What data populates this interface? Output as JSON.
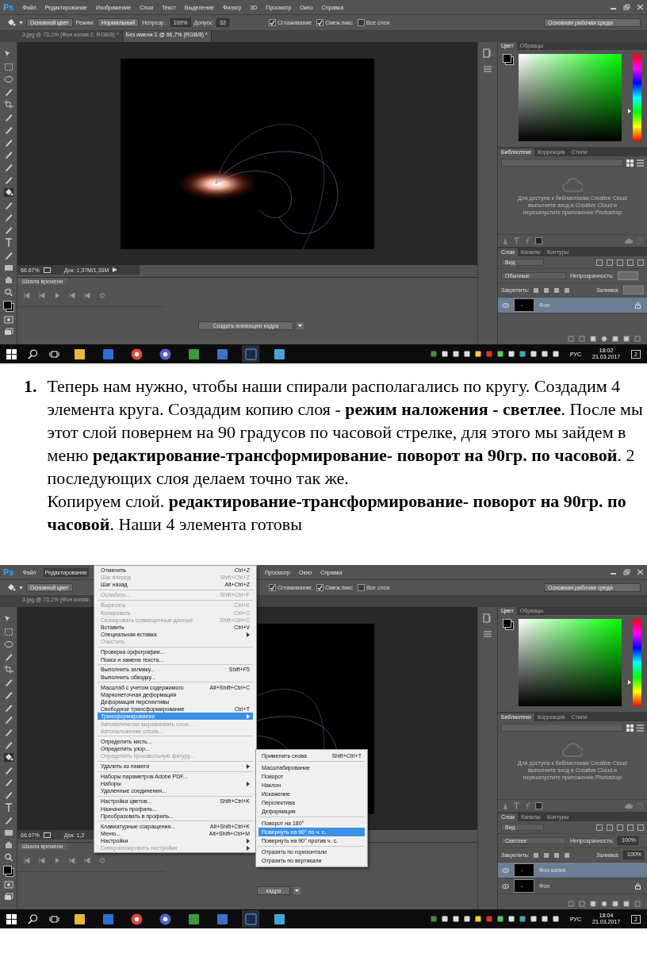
{
  "screenshots": [
    {
      "app_logo": "Ps",
      "menu_bar": [
        {
          "label": "Файл",
          "selected": false
        },
        {
          "label": "Редактирование",
          "selected": false
        },
        {
          "label": "Изображение",
          "selected": false
        },
        {
          "label": "Слои",
          "selected": false
        },
        {
          "label": "Текст",
          "selected": false
        },
        {
          "label": "Выделение",
          "selected": false
        },
        {
          "label": "Фильтр",
          "selected": false
        },
        {
          "label": "3D",
          "selected": false
        },
        {
          "label": "Просмотр",
          "selected": false
        },
        {
          "label": "Окно",
          "selected": false
        },
        {
          "label": "Справка",
          "selected": false
        }
      ],
      "options_bar": {
        "source": "Основной цвет",
        "mode_label": "Режим:",
        "mode": "Нормальный",
        "opacity_label": "Непрозр.:",
        "opacity": "100%",
        "tolerance_label": "Допуск:",
        "tolerance": "32",
        "checkboxes": [
          {
            "label": "Сглаживание",
            "checked": true
          },
          {
            "label": "Смеж.пикс",
            "checked": true
          },
          {
            "label": "Все слои",
            "checked": false
          }
        ],
        "workspace": "Основная рабочая среда"
      },
      "doc_tabs": [
        {
          "label": "3.jpg @ 73,1% (Фон копия 2, RGB/8) *",
          "selected": false
        },
        {
          "label": "Без имени-1 @ 66,7% (RGB/8) *",
          "selected": true
        }
      ],
      "status": {
        "zoom": "66.67%",
        "doc": "Док: 1,37M/1,33M"
      },
      "timeline": {
        "title": "Шкала времени",
        "button": "Создать анимацию кадра"
      },
      "panels": {
        "color_tabs": [
          {
            "label": "Цвет",
            "selected": true
          },
          {
            "label": "Образцы",
            "selected": false
          }
        ],
        "hue": {
          "level": 0.35
        },
        "library_tabs": [
          {
            "label": "Библиотеки",
            "selected": true
          },
          {
            "label": "Коррекция",
            "selected": false
          },
          {
            "label": "Стили",
            "selected": false
          }
        ],
        "library_message": "Для доступа к библиотекам Creative Cloud выполните вход в Creative Cloud и перезапустите приложение Photoshop",
        "layer_tabs": [
          {
            "label": "Слои",
            "selected": true
          },
          {
            "label": "Каналы",
            "selected": false
          },
          {
            "label": "Контуры",
            "selected": false
          }
        ],
        "filter": "Вид",
        "blend": "Обычные",
        "opacity_label": "Непрозрачность:",
        "lock_label": "Закрепить:",
        "fill_label": "Заливка:",
        "layers": [
          {
            "name": "Фон",
            "selected": true,
            "locked": true
          }
        ]
      },
      "taskbar": {
        "language": "РУС",
        "time": "18:02",
        "date": "21.03.2017",
        "notifications": "2"
      }
    },
    {
      "app_logo": "Ps",
      "menu_bar": [
        {
          "label": "Файл",
          "selected": false
        },
        {
          "label": "Редактирование",
          "selected": true
        },
        {
          "label": "Просмотр",
          "selected": false
        },
        {
          "label": "Окно",
          "selected": false
        },
        {
          "label": "Справка",
          "selected": false
        }
      ],
      "options_bar": {
        "source": "Основной цвет",
        "checkboxes": [
          {
            "label": "Сглаживание",
            "checked": true
          },
          {
            "label": "Смеж.пикс",
            "checked": true
          },
          {
            "label": "Все слои",
            "checked": false
          }
        ],
        "workspace": "Основная рабочая среда"
      },
      "doc_tabs": [
        {
          "label": "3.jpg @ 73,1% (Фон копия",
          "selected": false
        }
      ],
      "status": {
        "zoom": "66.67%",
        "doc": "Док: 1,3"
      },
      "timeline": {
        "title": "Шкала времени",
        "button": "кадра"
      },
      "panels": {
        "color_tabs": [
          {
            "label": "Цвет",
            "selected": true
          },
          {
            "label": "Образцы",
            "selected": false
          }
        ],
        "hue": {
          "level": 0.27
        },
        "library_tabs": [
          {
            "label": "Библиотеки",
            "selected": true
          },
          {
            "label": "Коррекция",
            "selected": false
          },
          {
            "label": "Стили",
            "selected": false
          }
        ],
        "library_message": "Для доступа к библиотекам Creative Cloud выполните вход в Creative Cloud и перезапустите приложение Photoshop",
        "layer_tabs": [
          {
            "label": "Слои",
            "selected": true
          },
          {
            "label": "Каналы",
            "selected": false
          },
          {
            "label": "Контуры",
            "selected": false
          }
        ],
        "filter": "Вид",
        "blend": "Светлее",
        "opacity_label": "Непрозрачность:",
        "opacity": "100%",
        "lock_label": "Закрепить:",
        "fill_label": "Заливка:",
        "fill": "100%",
        "layers": [
          {
            "name": "Фон копия",
            "selected": true,
            "locked": false
          },
          {
            "name": "Фон",
            "selected": false,
            "locked": true
          }
        ]
      },
      "taskbar": {
        "language": "РУС",
        "time": "18:04",
        "date": "21.03.2017",
        "notifications": "2"
      },
      "menu": {
        "groups": [
          [
            {
              "label": "Отменить",
              "shortcut": "Ctrl+Z",
              "disabled": false,
              "selected": false,
              "submenu": false
            },
            {
              "label": "Шаг вперед",
              "shortcut": "Shift+Ctrl+Z",
              "disabled": true,
              "selected": false,
              "submenu": false
            },
            {
              "label": "Шаг назад",
              "shortcut": "Alt+Ctrl+Z",
              "disabled": false,
              "selected": false,
              "submenu": false
            }
          ],
          [
            {
              "label": "Ослабить...",
              "shortcut": "Shift+Ctrl+F",
              "disabled": true,
              "selected": false,
              "submenu": false
            }
          ],
          [
            {
              "label": "Вырезать",
              "shortcut": "Ctrl+X",
              "disabled": true,
              "selected": false,
              "submenu": false
            },
            {
              "label": "Копировать",
              "shortcut": "Ctrl+C",
              "disabled": true,
              "selected": false,
              "submenu": false
            },
            {
              "label": "Скопировать совмещенные данные",
              "shortcut": "Shift+Ctrl+C",
              "disabled": true,
              "selected": false,
              "submenu": false
            },
            {
              "label": "Вставить",
              "shortcut": "Ctrl+V",
              "disabled": false,
              "selected": false,
              "submenu": false
            },
            {
              "label": "Специальная вставка",
              "disabled": false,
              "selected": false,
              "submenu": true
            },
            {
              "label": "Очистить",
              "disabled": true,
              "selected": false,
              "submenu": false
            }
          ],
          [
            {
              "label": "Проверка орфографии...",
              "disabled": false,
              "selected": false,
              "submenu": false
            },
            {
              "label": "Поиск и замена текста...",
              "disabled": false,
              "selected": false,
              "submenu": false
            }
          ],
          [
            {
              "label": "Выполнить заливку...",
              "shortcut": "Shift+F5",
              "disabled": false,
              "selected": false,
              "submenu": false
            },
            {
              "label": "Выполнить обводку...",
              "disabled": false,
              "selected": false,
              "submenu": false
            }
          ],
          [
            {
              "label": "Масштаб с учетом содержимого",
              "shortcut": "Alt+Shift+Ctrl+C",
              "disabled": false,
              "selected": false,
              "submenu": false
            },
            {
              "label": "Марионеточная деформация",
              "disabled": false,
              "selected": false,
              "submenu": false
            },
            {
              "label": "Деформация перспективы",
              "disabled": false,
              "selected": false,
              "submenu": false
            },
            {
              "label": "Свободное трансформирование",
              "shortcut": "Ctrl+T",
              "disabled": false,
              "selected": false,
              "submenu": false
            },
            {
              "label": "Трансформирование",
              "disabled": false,
              "selected": true,
              "submenu": true
            },
            {
              "label": "Автоматически выравнивать слои...",
              "disabled": true,
              "selected": false,
              "submenu": false
            },
            {
              "label": "Автоналожение слоев...",
              "disabled": true,
              "selected": false,
              "submenu": false
            }
          ],
          [
            {
              "label": "Определить кисть...",
              "disabled": false,
              "selected": false,
              "submenu": false
            },
            {
              "label": "Определить узор...",
              "disabled": false,
              "selected": false,
              "submenu": false
            },
            {
              "label": "Определить произвольную фигуру...",
              "disabled": true,
              "selected": false,
              "submenu": false
            }
          ],
          [
            {
              "label": "Удалить из памяти",
              "disabled": false,
              "selected": false,
              "submenu": true
            }
          ],
          [
            {
              "label": "Наборы параметров Adobe PDF...",
              "disabled": false,
              "selected": false,
              "submenu": false
            },
            {
              "label": "Наборы",
              "disabled": false,
              "selected": false,
              "submenu": true
            },
            {
              "label": "Удаленные соединения...",
              "disabled": false,
              "selected": false,
              "submenu": false
            }
          ],
          [
            {
              "label": "Настройка цветов...",
              "shortcut": "Shift+Ctrl+K",
              "disabled": false,
              "selected": false,
              "submenu": false
            },
            {
              "label": "Назначить профиль...",
              "disabled": false,
              "selected": false,
              "submenu": false
            },
            {
              "label": "Преобразовать в профиль...",
              "disabled": false,
              "selected": false,
              "submenu": false
            }
          ],
          [
            {
              "label": "Клавиатурные сокращения...",
              "shortcut": "Alt+Shift+Ctrl+K",
              "disabled": false,
              "selected": false,
              "submenu": false
            },
            {
              "label": "Меню...",
              "shortcut": "Alt+Shift+Ctrl+M",
              "disabled": false,
              "selected": false,
              "submenu": false
            },
            {
              "label": "Настройки",
              "disabled": false,
              "selected": false,
              "submenu": true
            },
            {
              "label": "Синхронизировать настройки",
              "disabled": true,
              "selected": false,
              "submenu": true
            }
          ]
        ],
        "submenu": [
          [
            {
              "label": "Применить снова",
              "shortcut": "Shift+Ctrl+T",
              "selected": false
            }
          ],
          [
            {
              "label": "Масштабирование",
              "selected": false
            },
            {
              "label": "Поворот",
              "selected": false
            },
            {
              "label": "Наклон",
              "selected": false
            },
            {
              "label": "Искажение",
              "selected": false
            },
            {
              "label": "Перспектива",
              "selected": false
            },
            {
              "label": "Деформация",
              "selected": false
            }
          ],
          [
            {
              "label": "Поворот на 180°",
              "selected": false
            },
            {
              "label": "Повернуть на 90° по ч. с.",
              "selected": true
            },
            {
              "label": "Повернуть на 90° против ч. с.",
              "selected": false
            }
          ],
          [
            {
              "label": "Отразить по горизонтали",
              "selected": false
            },
            {
              "label": "Отразить по вертикали",
              "selected": false
            }
          ]
        ]
      }
    }
  ],
  "instruction": {
    "number": "1.",
    "paragraphs": [
      "Теперь нам нужно, чтобы наши спирали располагались по кругу. Создадим 4 элемента круга. Создадим копию слоя - **режим наложения - светлее**. После мы этот слой повернем на 90 градусов по часовой стрелке, для этого мы зайдем в меню **редактирование-трансформирование- поворот на 90гр. по часовой**. 2 последующих слоя делаем точно так же.",
      "Копируем слой. **редактирование-трансформирование- поворот на 90гр. по часовой**. Наши 4 элемента готовы"
    ]
  }
}
